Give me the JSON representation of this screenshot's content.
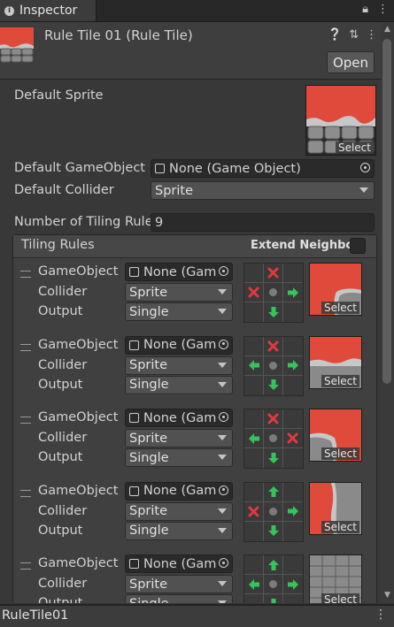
{
  "tab": {
    "label": "Inspector"
  },
  "header": {
    "title": "Rule Tile 01 (Rule Tile)",
    "open_label": "Open"
  },
  "fields": {
    "default_sprite_label": "Default Sprite",
    "sprite_select": "Select",
    "default_gameobject_label": "Default GameObject",
    "default_gameobject_value": "None (Game Object)",
    "default_collider_label": "Default Collider",
    "default_collider_value": "Sprite",
    "num_rules_label": "Number of Tiling Rule",
    "num_rules_value": "9"
  },
  "tiling_rules": {
    "title": "Tiling Rules",
    "extend_label": "Extend Neighbor",
    "row_labels": {
      "gameobject": "GameObject",
      "collider": "Collider",
      "output": "Output"
    },
    "rules": [
      {
        "gameobject": "None (Gam",
        "collider": "Sprite",
        "output": "Single",
        "select": "Select",
        "cells": [
          "",
          "x",
          "",
          "x",
          "dot",
          "right",
          "",
          "down",
          ""
        ],
        "sprite_variant": "corner-tl"
      },
      {
        "gameobject": "None (Gam",
        "collider": "Sprite",
        "output": "Single",
        "select": "Select",
        "cells": [
          "",
          "x",
          "",
          "left",
          "dot",
          "right",
          "",
          "down",
          ""
        ],
        "sprite_variant": "top"
      },
      {
        "gameobject": "None (Gam",
        "collider": "Sprite",
        "output": "Single",
        "select": "Select",
        "cells": [
          "",
          "x",
          "",
          "left",
          "dot",
          "x",
          "",
          "down",
          ""
        ],
        "sprite_variant": "corner-tr"
      },
      {
        "gameobject": "None (Gam",
        "collider": "Sprite",
        "output": "Single",
        "select": "Select",
        "cells": [
          "",
          "up",
          "",
          "x",
          "dot",
          "right",
          "",
          "down",
          ""
        ],
        "sprite_variant": "left"
      },
      {
        "gameobject": "None (Gam",
        "collider": "Sprite",
        "output": "Single",
        "select": "Select",
        "cells": [
          "",
          "up",
          "",
          "left",
          "dot",
          "right",
          "",
          "down",
          ""
        ],
        "sprite_variant": "center"
      }
    ]
  },
  "footer": {
    "name": "RuleTile01"
  },
  "colors": {
    "red": "#e04a3a",
    "stone": "#9a9a9a",
    "green_arrow": "#35c45a",
    "red_x": "#e03a3a"
  }
}
